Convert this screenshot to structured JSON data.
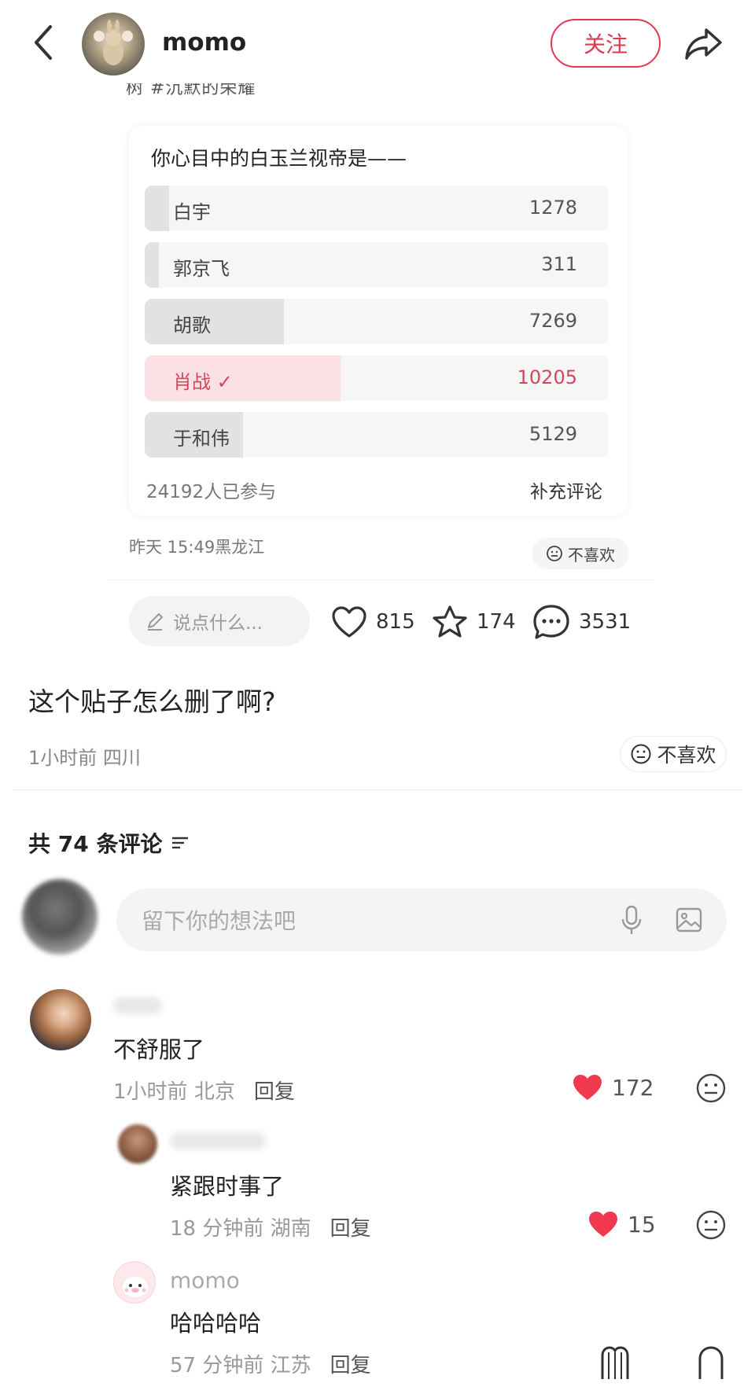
{
  "header": {
    "username": "momo",
    "follow_label": "关注"
  },
  "embedded": {
    "cut_text": "树 #沉默的荣耀",
    "poll": {
      "title": "你心目中的白玉兰视帝是——",
      "options": [
        {
          "label": "白宇",
          "count": "1278",
          "share": 0.053,
          "selected": false
        },
        {
          "label": "郭京飞",
          "count": "311",
          "share": 0.013,
          "selected": false
        },
        {
          "label": "胡歌",
          "count": "7269",
          "share": 0.3,
          "selected": false
        },
        {
          "label": "肖战 ✓",
          "count": "10205",
          "share": 0.422,
          "selected": true
        },
        {
          "label": "于和伟",
          "count": "5129",
          "share": 0.212,
          "selected": false
        }
      ],
      "participants": "24192人已参与",
      "more_label": "补充评论"
    },
    "meta": "昨天 15:49黑龙江",
    "dislike_label": "不喜欢",
    "say_placeholder": "说点什么...",
    "likes": "815",
    "favorites": "174",
    "comments": "3531"
  },
  "post": {
    "text": "这个贴子怎么删了啊?",
    "meta": "1小时前 四川",
    "dislike_label": "不喜欢"
  },
  "comments_section": {
    "header": "共 74 条评论",
    "input_placeholder": "留下你的想法吧"
  },
  "comments": [
    {
      "text": "不舒服了",
      "time": "1小时前",
      "location": "北京",
      "reply_label": "回复",
      "likes": "172"
    },
    {
      "text": "紧跟时事了",
      "time": "18 分钟前",
      "location": "湖南",
      "reply_label": "回复",
      "likes": "15"
    },
    {
      "name": "momo",
      "text": "哈哈哈哈",
      "time": "57 分钟前",
      "location": "江苏",
      "reply_label": "回复"
    }
  ],
  "colors": {
    "accent": "#e0394f",
    "like_red": "#f0384e",
    "poll_selected_bg": "#fbe1e5"
  }
}
